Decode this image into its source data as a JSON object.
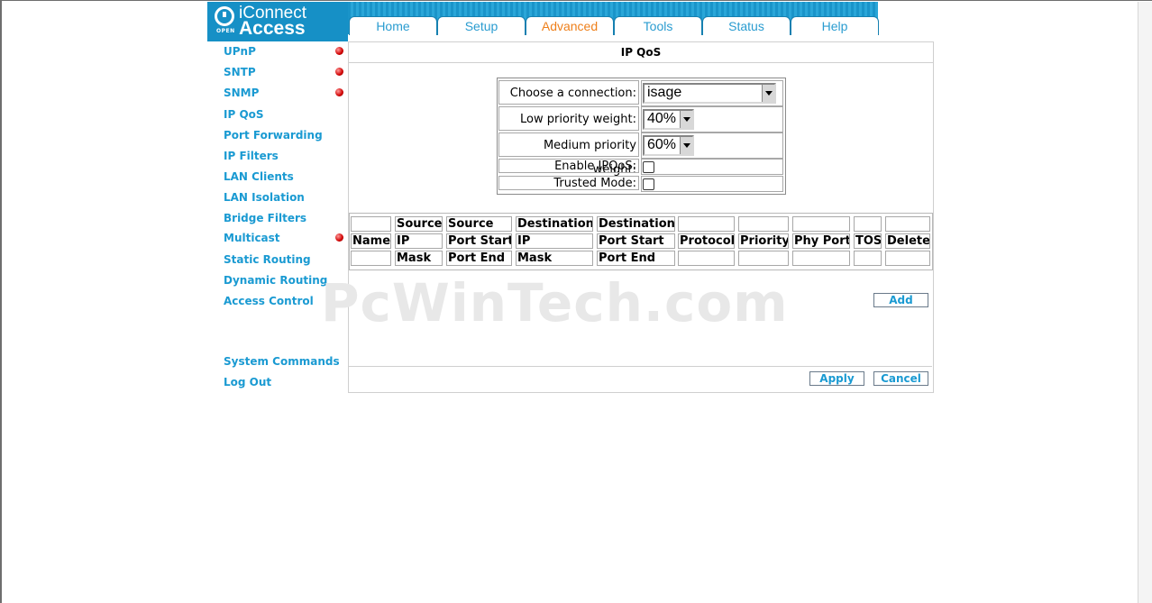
{
  "logo": {
    "badge": "OPEN",
    "line1": "iConnect",
    "line2": "Access"
  },
  "tabs": [
    {
      "label": "Home",
      "active": false
    },
    {
      "label": "Setup",
      "active": false
    },
    {
      "label": "Advanced",
      "active": true
    },
    {
      "label": "Tools",
      "active": false
    },
    {
      "label": "Status",
      "active": false
    },
    {
      "label": "Help",
      "active": false
    }
  ],
  "sidebar": {
    "items": [
      {
        "label": "UPnP",
        "alert": true
      },
      {
        "label": "SNTP",
        "alert": true
      },
      {
        "label": "SNMP",
        "alert": true
      },
      {
        "label": "IP QoS",
        "alert": false
      },
      {
        "label": "Port Forwarding",
        "alert": false
      },
      {
        "label": "IP Filters",
        "alert": false
      },
      {
        "label": "LAN Clients",
        "alert": false
      },
      {
        "label": "LAN Isolation",
        "alert": false
      },
      {
        "label": "Bridge Filters",
        "alert": false
      },
      {
        "label": "Multicast",
        "alert": true
      },
      {
        "label": "Static Routing",
        "alert": false
      },
      {
        "label": "Dynamic Routing",
        "alert": false
      },
      {
        "label": "Access Control",
        "alert": false
      }
    ],
    "system_commands": "System Commands",
    "log_out": "Log Out"
  },
  "page_title": "IP QoS",
  "form": {
    "connection_label": "Choose a connection:",
    "connection_value": "isage",
    "low_label": "Low priority weight:",
    "low_value": "40%",
    "medium_label": "Medium priority weight:",
    "medium_value": "60%",
    "enable_label": "Enable IPQoS:",
    "enable_checked": false,
    "trusted_label": "Trusted Mode:",
    "trusted_checked": false
  },
  "rules_table": {
    "headers": {
      "name": [
        "",
        "Name",
        ""
      ],
      "src_ip": [
        "Source",
        "IP",
        "Mask"
      ],
      "src_port": [
        "Source",
        "Port Start",
        "Port End"
      ],
      "dst_ip": [
        "Destination",
        "IP",
        "Mask"
      ],
      "dst_port": [
        "Destination",
        "Port Start",
        "Port End"
      ],
      "protocol": [
        "",
        "Protocol",
        ""
      ],
      "priority": [
        "",
        "Priority",
        ""
      ],
      "phy_port": [
        "",
        "Phy Port",
        ""
      ],
      "tos": [
        "",
        "TOS",
        ""
      ],
      "delete": [
        "",
        "Delete",
        ""
      ]
    }
  },
  "buttons": {
    "add": "Add",
    "apply": "Apply",
    "cancel": "Cancel"
  },
  "watermark": "PcWinTech.com",
  "colors": {
    "accent": "#1a9ad2",
    "active_tab": "#ee7f1a",
    "alert": "#d00000"
  }
}
